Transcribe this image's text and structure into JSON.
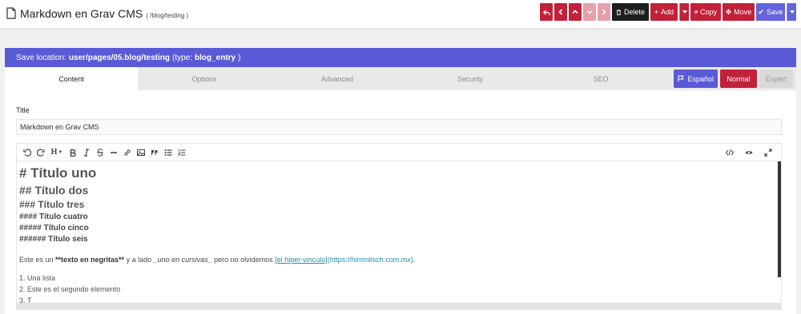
{
  "header": {
    "title": "Markdown en Grav CMS",
    "route": "( /blog/testing )"
  },
  "actions": {
    "delete": "Delete",
    "add": "Add",
    "copy": "Copy",
    "move": "Move",
    "save": "Save"
  },
  "save_location": {
    "prefix": "Save location:",
    "path": "user/pages/05.blog/testing",
    "type_prefix": "(type:",
    "type": "blog_entry",
    "type_suffix": ")"
  },
  "tabs": [
    "Content",
    "Options",
    "Advanced",
    "Security",
    "SEO"
  ],
  "language": "Español",
  "mode": {
    "normal": "Normal",
    "expert": "Expert"
  },
  "form": {
    "title_label": "Title",
    "title_value": "Markdown en Grav CMS"
  },
  "editor": {
    "toolbar_heading": "H",
    "h1": "# Título uno",
    "h2": "## Título dos",
    "h3": "### Título tres",
    "h4": "#### Título cuatro",
    "h5": "##### Título cinco",
    "h6": "######  Título seis",
    "para_1": "Este es un ",
    "para_bold": "**texto en negritas**",
    "para_2": " y a lado ",
    "para_italic": "_uno en cursivas_",
    "para_3": " pero no olvidemos ",
    "para_link_text": "[el hiper-vinculo]",
    "para_link_url": "(https://himmlisch.com.mx)",
    "para_end": ".",
    "list_1": "1. Una lista",
    "list_2": "2. Este es el segundo elemento",
    "list_3": "3. T"
  },
  "colors": {
    "accent_blue": "#5a5ad6",
    "action_red": "#c2213a",
    "delete_black": "#1e1e1e"
  }
}
